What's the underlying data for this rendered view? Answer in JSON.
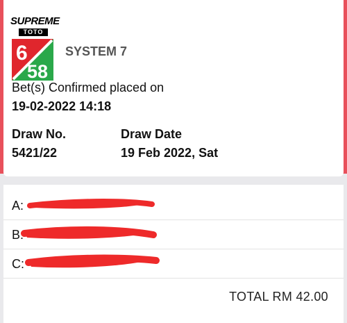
{
  "logo": {
    "brand_top": "SUPREME",
    "brand_mid": "TOTO",
    "numerator": "6",
    "denominator": "58"
  },
  "game": {
    "system_label": "SYSTEM 7"
  },
  "confirmation": {
    "text": "Bet(s) Confirmed placed on",
    "datetime": "19-02-2022 14:18"
  },
  "draw": {
    "no_label": "Draw No.",
    "no_value": "5421/22",
    "date_label": "Draw Date",
    "date_value": "19 Feb 2022, Sat"
  },
  "bets": [
    {
      "label": "A:"
    },
    {
      "label": "B:"
    },
    {
      "label": "C:"
    }
  ],
  "total": {
    "text": "TOTAL RM 42.00"
  },
  "colors": {
    "accent_red": "#e8505b",
    "logo_green": "#2aa84a",
    "logo_red": "#e0262d",
    "redaction_red": "#ee2a2a"
  }
}
